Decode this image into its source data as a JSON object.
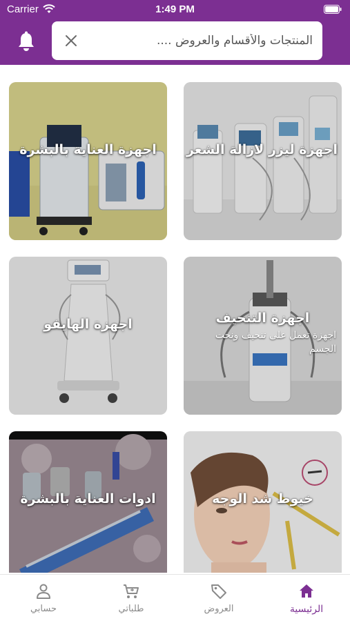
{
  "status_bar": {
    "carrier": "Carrier",
    "time": "1:49 PM"
  },
  "header": {
    "search": {
      "placeholder": "المنتجات والأقسام والعروض ...."
    },
    "bell_icon": "bell-icon",
    "clear_icon": "close-icon"
  },
  "categories": [
    {
      "title": "اجهزة ليزر لازالة الشعر"
    },
    {
      "title": "اجهزة العناية بالبشرة"
    },
    {
      "title": "اجهزة التنحيف",
      "subtitle": "اجهزة تعمل على تنحيف ونحت الجسم"
    },
    {
      "title": "اجهزة الهايفو"
    },
    {
      "title": "خيوط شد الوجه"
    },
    {
      "title": "ادوات العناية بالبشرة"
    }
  ],
  "tabbar": {
    "tabs": [
      {
        "label": "الرئيسية",
        "icon": "home-icon",
        "active": true
      },
      {
        "label": "العروض",
        "icon": "tag-icon"
      },
      {
        "label": "طلباتي",
        "icon": "cart-icon"
      },
      {
        "label": "حسابي",
        "icon": "person-icon"
      }
    ]
  },
  "colors": {
    "brand": "#7c2f92",
    "inactive": "#8a8a8a"
  }
}
